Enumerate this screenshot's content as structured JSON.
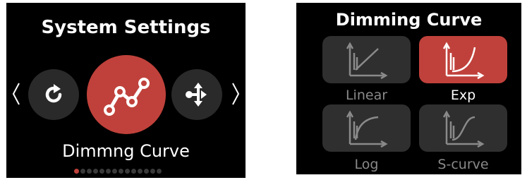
{
  "left_screen": {
    "title": "System Settings",
    "menu_items": [
      {
        "icon": "reset-icon"
      },
      {
        "icon": "line-graph-icon",
        "selected": true
      },
      {
        "icon": "network-icon"
      }
    ],
    "selected_label": "Dimmng Curve",
    "page_indicator": {
      "total": 14,
      "current": 1
    }
  },
  "right_screen": {
    "title": "Dimming Curve",
    "options": [
      {
        "label": "Linear",
        "selected": false
      },
      {
        "label": "Exp",
        "selected": true
      },
      {
        "label": "Log",
        "selected": false
      },
      {
        "label": "S-curve",
        "selected": false
      }
    ]
  },
  "colors": {
    "accent": "#c0413b",
    "screen_bg": "#000000",
    "button_bg": "#2a2a2a",
    "tile_bg": "#2f2f2f",
    "dim_text": "#8a8a8a"
  }
}
